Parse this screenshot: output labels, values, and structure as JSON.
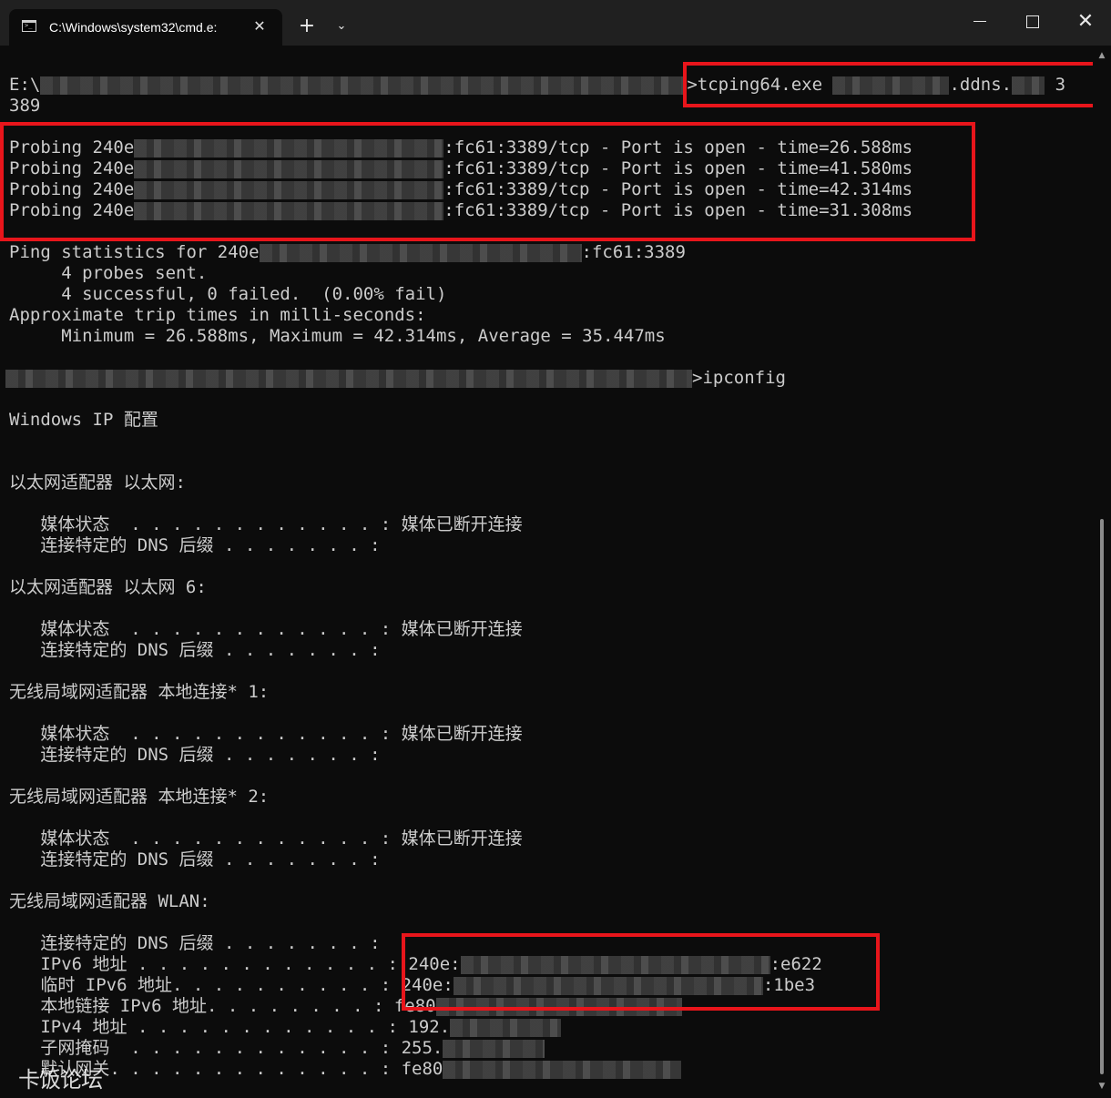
{
  "window": {
    "tab_title": "C:\\Windows\\system32\\cmd.e:",
    "tab_icon": "terminal-icon",
    "tab_close": "✕",
    "new_tab": "+",
    "dropdown": "⌄",
    "close": "✕"
  },
  "terminal": {
    "cmd1_prefix": "E:\\",
    "cmd1_command": ">tcping64.exe ",
    "cmd1_ddns": ".ddns.",
    "cmd1_port_tail": " 3",
    "cmd1_wrap": "389",
    "probes": [
      {
        "prefix": "Probing 240e",
        "suffix": ":fc61:3389/tcp - Port is open - time=26.588ms"
      },
      {
        "prefix": "Probing 240e",
        "suffix": ":fc61:3389/tcp - Port is open - time=41.580ms"
      },
      {
        "prefix": "Probing 240e",
        "suffix": ":fc61:3389/tcp - Port is open - time=42.314ms"
      },
      {
        "prefix": "Probing 240e",
        "suffix": ":fc61:3389/tcp - Port is open - time=31.308ms"
      }
    ],
    "stats_prefix": "Ping statistics for 240e",
    "stats_suffix": ":fc61:3389",
    "probes_sent": "     4 probes sent.",
    "success_line": "     4 successful, 0 failed.  (0.00% fail)",
    "approx_line": "Approximate trip times in milli-seconds:",
    "minmax_line": "     Minimum = 26.588ms, Maximum = 42.314ms, Average = 35.447ms",
    "cmd2_command": ">ipconfig",
    "ip_config_title": "Windows IP 配置",
    "adapters": [
      {
        "header": "以太网适配器 以太网:",
        "media_label": "   媒体状态  . . . . . . . . . . . . : 媒体已断开连接",
        "dns_label": "   连接特定的 DNS 后缀 . . . . . . . :"
      },
      {
        "header": "以太网适配器 以太网 6:",
        "media_label": "   媒体状态  . . . . . . . . . . . . : 媒体已断开连接",
        "dns_label": "   连接特定的 DNS 后缀 . . . . . . . :"
      },
      {
        "header": "无线局域网适配器 本地连接* 1:",
        "media_label": "   媒体状态  . . . . . . . . . . . . : 媒体已断开连接",
        "dns_label": "   连接特定的 DNS 后缀 . . . . . . . :"
      },
      {
        "header": "无线局域网适配器 本地连接* 2:",
        "media_label": "   媒体状态  . . . . . . . . . . . . : 媒体已断开连接",
        "dns_label": "   连接特定的 DNS 后缀 . . . . . . . :"
      }
    ],
    "wlan": {
      "header": "无线局域网适配器 WLAN:",
      "dns_label": "   连接特定的 DNS 后缀 . . . . . . . :",
      "ipv6_label": "   IPv6 地址 . . . . . . . . . . . . : ",
      "ipv6_prefix": "240e:",
      "ipv6_suffix": ":e622",
      "temp_ipv6_label": "   临时 IPv6 地址. . . . . . . . . . : ",
      "temp_ipv6_prefix": "240e:",
      "temp_ipv6_suffix": ":1be3",
      "link_local_label": "   本地链接 IPv6 地址. . . . . . . . : ",
      "link_local_prefix": "fe80",
      "ipv4_label": "   IPv4 地址 . . . . . . . . . . . . : ",
      "ipv4_prefix": "192.",
      "mask_label": "   子网掩码  . . . . . . . . . . . . : ",
      "mask_prefix": "255.",
      "gateway_label": "   默认网关. . . . . . . . . . . . . : ",
      "gateway_prefix": "fe80"
    }
  },
  "watermark": "卡饭论坛",
  "colors": {
    "background": "#0c0c0c",
    "titlebar": "#202020",
    "text": "#cccccc",
    "highlight_box": "#e8151b"
  }
}
